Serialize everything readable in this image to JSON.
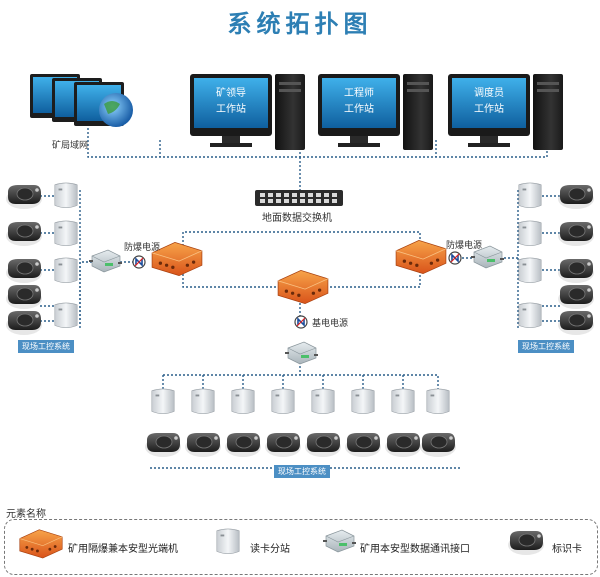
{
  "title": "系统拓扑图",
  "mine_lan": "矿局域网",
  "workstations": [
    {
      "line1": "矿领导",
      "line2": "工作站"
    },
    {
      "line1": "工程师",
      "line2": "工作站"
    },
    {
      "line1": "调度员",
      "line2": "工作站"
    }
  ],
  "switch_label": "地面数据交换机",
  "explosion_power_left": "防爆电源",
  "explosion_power_right": "防爆电源",
  "base_power": "基电电源",
  "field_system_left": "现场工控系统",
  "field_system_right": "现场工控系统",
  "field_system_bottom": "现场工控系统",
  "legend": {
    "title": "元素名称",
    "items": [
      "矿用隔爆兼本安型光端机",
      "读卡分站",
      "矿用本安型数据通讯接口",
      "标识卡"
    ]
  },
  "colors": {
    "accent": "#2d7fb4",
    "line": "#2a5e8a",
    "orange": "#e8641e",
    "screen": "#1c88c9"
  }
}
